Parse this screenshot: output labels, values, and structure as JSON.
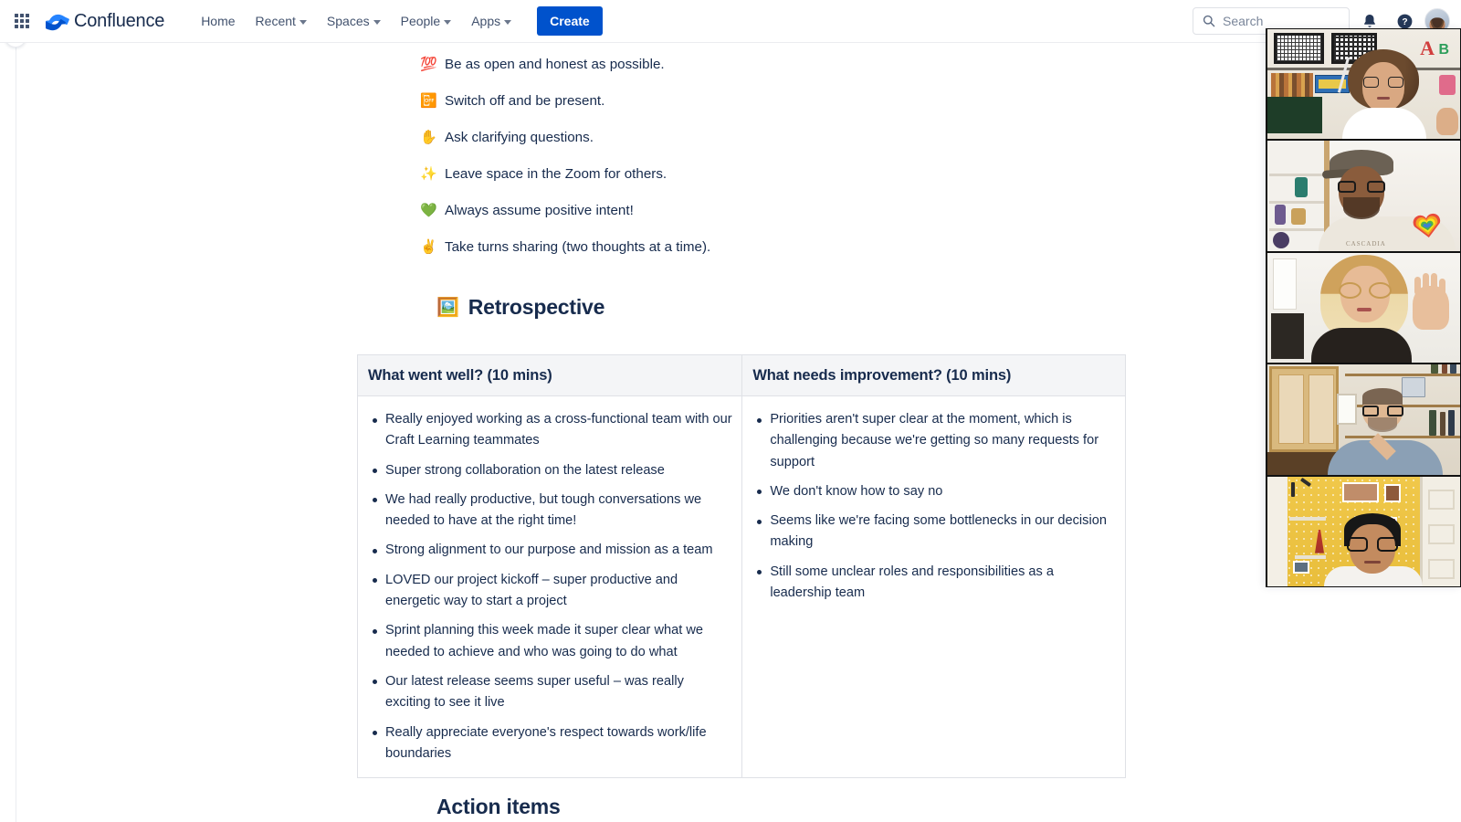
{
  "nav": {
    "app_switcher_label": "App switcher",
    "product_name": "Confluence",
    "links": [
      {
        "label": "Home",
        "has_caret": false
      },
      {
        "label": "Recent",
        "has_caret": true
      },
      {
        "label": "Spaces",
        "has_caret": true
      },
      {
        "label": "People",
        "has_caret": true
      },
      {
        "label": "Apps",
        "has_caret": true
      }
    ],
    "create_label": "Create",
    "search": {
      "value": "",
      "placeholder": "Search"
    },
    "icons": {
      "notifications": "bell-icon",
      "help": "help-icon",
      "profile": "avatar"
    },
    "accent_color": "#0052CC",
    "text_color": "#42526E"
  },
  "sidebar": {
    "expand_label": "Expand sidebar",
    "expand_icon": "chevron-right-icon"
  },
  "page": {
    "ground_rules": [
      {
        "emoji": "💯",
        "text": "Be as open and honest as possible."
      },
      {
        "emoji": "📴",
        "text": "Switch off and be present."
      },
      {
        "emoji": "✋",
        "text": "Ask clarifying questions."
      },
      {
        "emoji": "✨",
        "text": "Leave space in the Zoom for others."
      },
      {
        "emoji": "💚",
        "text": "Always assume positive intent!"
      },
      {
        "emoji": "✌️",
        "text": "Take turns sharing (two thoughts at a time)."
      }
    ],
    "retrospective_heading": {
      "emoji": "🖼️",
      "text": "Retrospective"
    },
    "table": {
      "headers": [
        "What went well? (10 mins)",
        "What needs improvement? (10 mins)"
      ],
      "columns": [
        [
          "Really enjoyed working as a cross-functional team with our Craft Learning teammates",
          "Super strong collaboration on the latest release",
          "We had really productive, but tough conversations we needed to have at the right time!",
          "Strong alignment to our purpose and mission as a team",
          "LOVED our project kickoff – super productive and energetic way to start a project",
          "Sprint planning this week made it super clear what we needed to achieve and who was going to do what",
          "Our latest release seems super useful – was really exciting to see it live",
          "Really appreciate everyone's respect towards work/life boundaries"
        ],
        [
          "Priorities aren't super clear at the moment, which is challenging because we're getting so many requests for support",
          "We don't know how to say no",
          "Seems like we're facing some bottlenecks in our decision making",
          "Still some unclear roles and responsibilities as a leadership team"
        ]
      ],
      "header_background": "#F4F5F7",
      "border_color": "#DFE1E6"
    },
    "action_items_heading": "Action items"
  },
  "video_call": {
    "participants": [
      {
        "name": "participant-1",
        "description": "woman with curly hair and glasses in front of shelves with framed artwork"
      },
      {
        "name": "participant-2",
        "description": "man in flat cap and glasses with rainbow heart graphic on shirt"
      },
      {
        "name": "participant-3",
        "description": "woman with blonde hair and round glasses waving"
      },
      {
        "name": "participant-4",
        "description": "man with glasses in front of bookshelves and a wooden cabinet"
      },
      {
        "name": "participant-5",
        "description": "man with glasses in front of a yellow pegboard wall"
      }
    ]
  }
}
